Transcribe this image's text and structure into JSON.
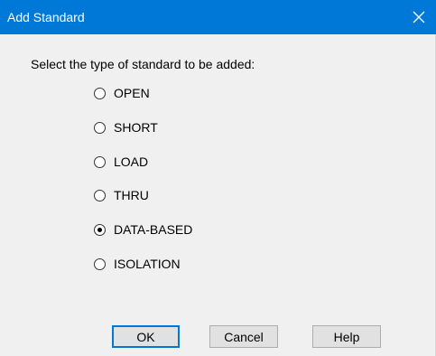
{
  "window": {
    "title": "Add Standard",
    "accent_color": "#0078d7",
    "close_icon": "close-icon"
  },
  "prompt": "Select the type of standard to be added:",
  "options": [
    {
      "label": "OPEN",
      "selected": false
    },
    {
      "label": "SHORT",
      "selected": false
    },
    {
      "label": "LOAD",
      "selected": false
    },
    {
      "label": "THRU",
      "selected": false
    },
    {
      "label": "DATA-BASED",
      "selected": true
    },
    {
      "label": "ISOLATION",
      "selected": false
    }
  ],
  "buttons": {
    "ok": "OK",
    "cancel": "Cancel",
    "help": "Help"
  }
}
